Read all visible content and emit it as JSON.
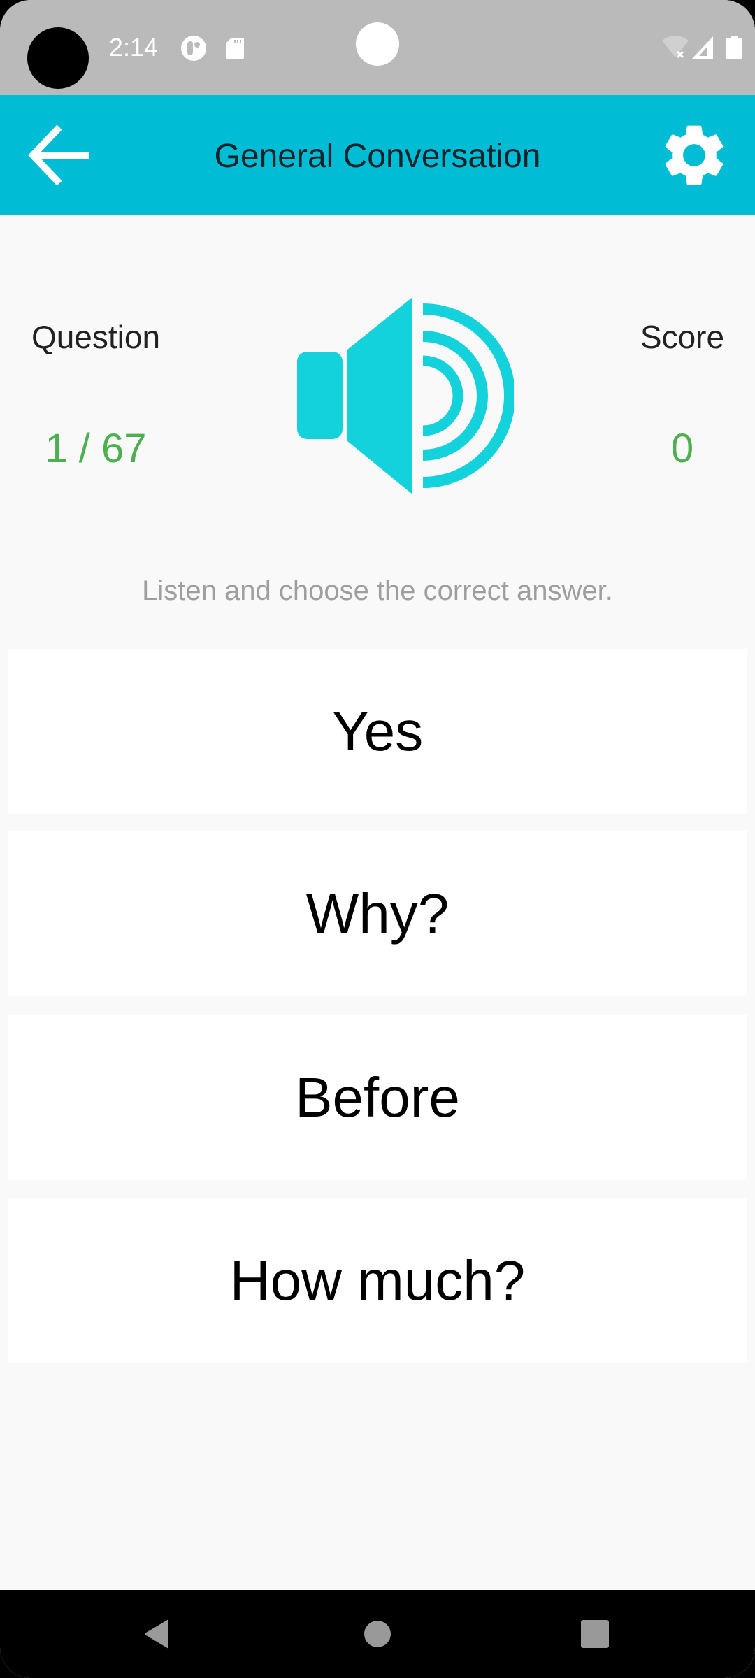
{
  "status_bar": {
    "time": "2:14",
    "icons": [
      "camera-cutout",
      "notification-app-icon",
      "sd-card-icon",
      "wifi-off-icon",
      "cell-signal-icon",
      "battery-icon"
    ]
  },
  "toolbar": {
    "title": "General Conversation",
    "back_icon": "arrow-left-icon",
    "settings_icon": "gear-icon"
  },
  "quiz": {
    "question_label": "Question",
    "question_progress": "1 / 67",
    "score_label": "Score",
    "score_value": "0",
    "play_icon": "speaker-icon",
    "instruction": "Listen and choose the correct answer.",
    "answers": [
      {
        "label": "Yes"
      },
      {
        "label": "Why?"
      },
      {
        "label": "Before"
      },
      {
        "label": "How much?"
      }
    ]
  },
  "nav_bar": {
    "back": "nav-back-icon",
    "home": "nav-home-icon",
    "recents": "nav-recents-icon"
  },
  "colors": {
    "toolbar": "#00bcd4",
    "accent_icon": "#14d2dc",
    "value_green": "#4caf50",
    "instruction_gray": "#9e9e9e",
    "status_bar": "#bababa"
  }
}
